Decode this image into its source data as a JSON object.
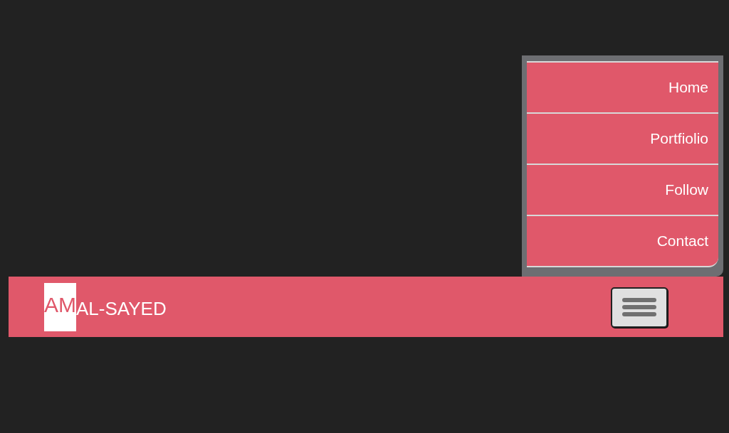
{
  "navbar": {
    "logo": {
      "highlight": "AM",
      "rest": "AL-SAYED"
    },
    "menu_button": {
      "expanded": true
    }
  },
  "menu": {
    "items": [
      {
        "label": "Home"
      },
      {
        "label": "Portfiolio"
      },
      {
        "label": "Follow"
      },
      {
        "label": "Contact"
      }
    ]
  }
}
